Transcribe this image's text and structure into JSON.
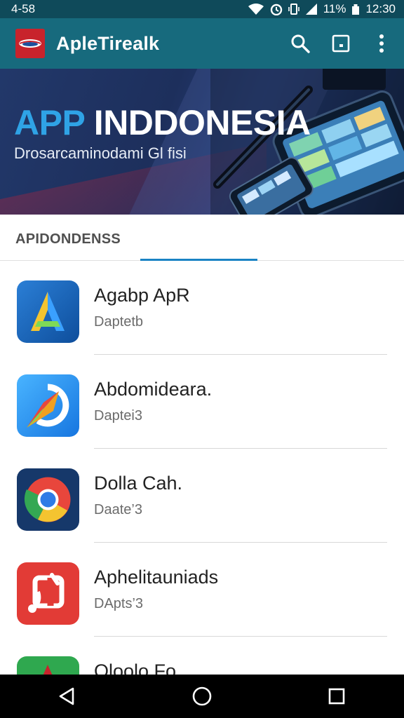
{
  "status_bar": {
    "time_left": "4-58",
    "battery": "11%",
    "clock": "12:30"
  },
  "app_bar": {
    "title": "ApleTirealk",
    "logo_icon": "app-logo-icon",
    "actions": [
      "search-icon",
      "window-icon",
      "more-vert-icon"
    ]
  },
  "banner": {
    "title_accent": "APP",
    "title_rest": " INDDONESIA",
    "subtitle": "Drosarcaminodami Gl fisi"
  },
  "tabs": {
    "label": "APIDONDENSS",
    "accent_color": "#1a83c4"
  },
  "apps": [
    {
      "name": "Agabp ApR",
      "subtitle": "Daptetb",
      "icon": "a-letter-icon"
    },
    {
      "name": "Abdomideara.",
      "subtitle": "Daptei3",
      "icon": "compass-arrow-icon"
    },
    {
      "name": "Dolla Cah.",
      "subtitle": "Daate’3",
      "icon": "chrome-style-icon"
    },
    {
      "name": "Aphelitauniads",
      "subtitle": "DApts’3",
      "icon": "music-note-icon"
    },
    {
      "name": "Oloolo Fo",
      "subtitle": "",
      "icon": "green-app-icon"
    }
  ],
  "colors": {
    "status_bar": "#0f4a5a",
    "app_bar": "#176a7d",
    "logo_red": "#c8232c"
  },
  "nav_bar": [
    "back-icon",
    "home-icon",
    "recents-icon"
  ]
}
